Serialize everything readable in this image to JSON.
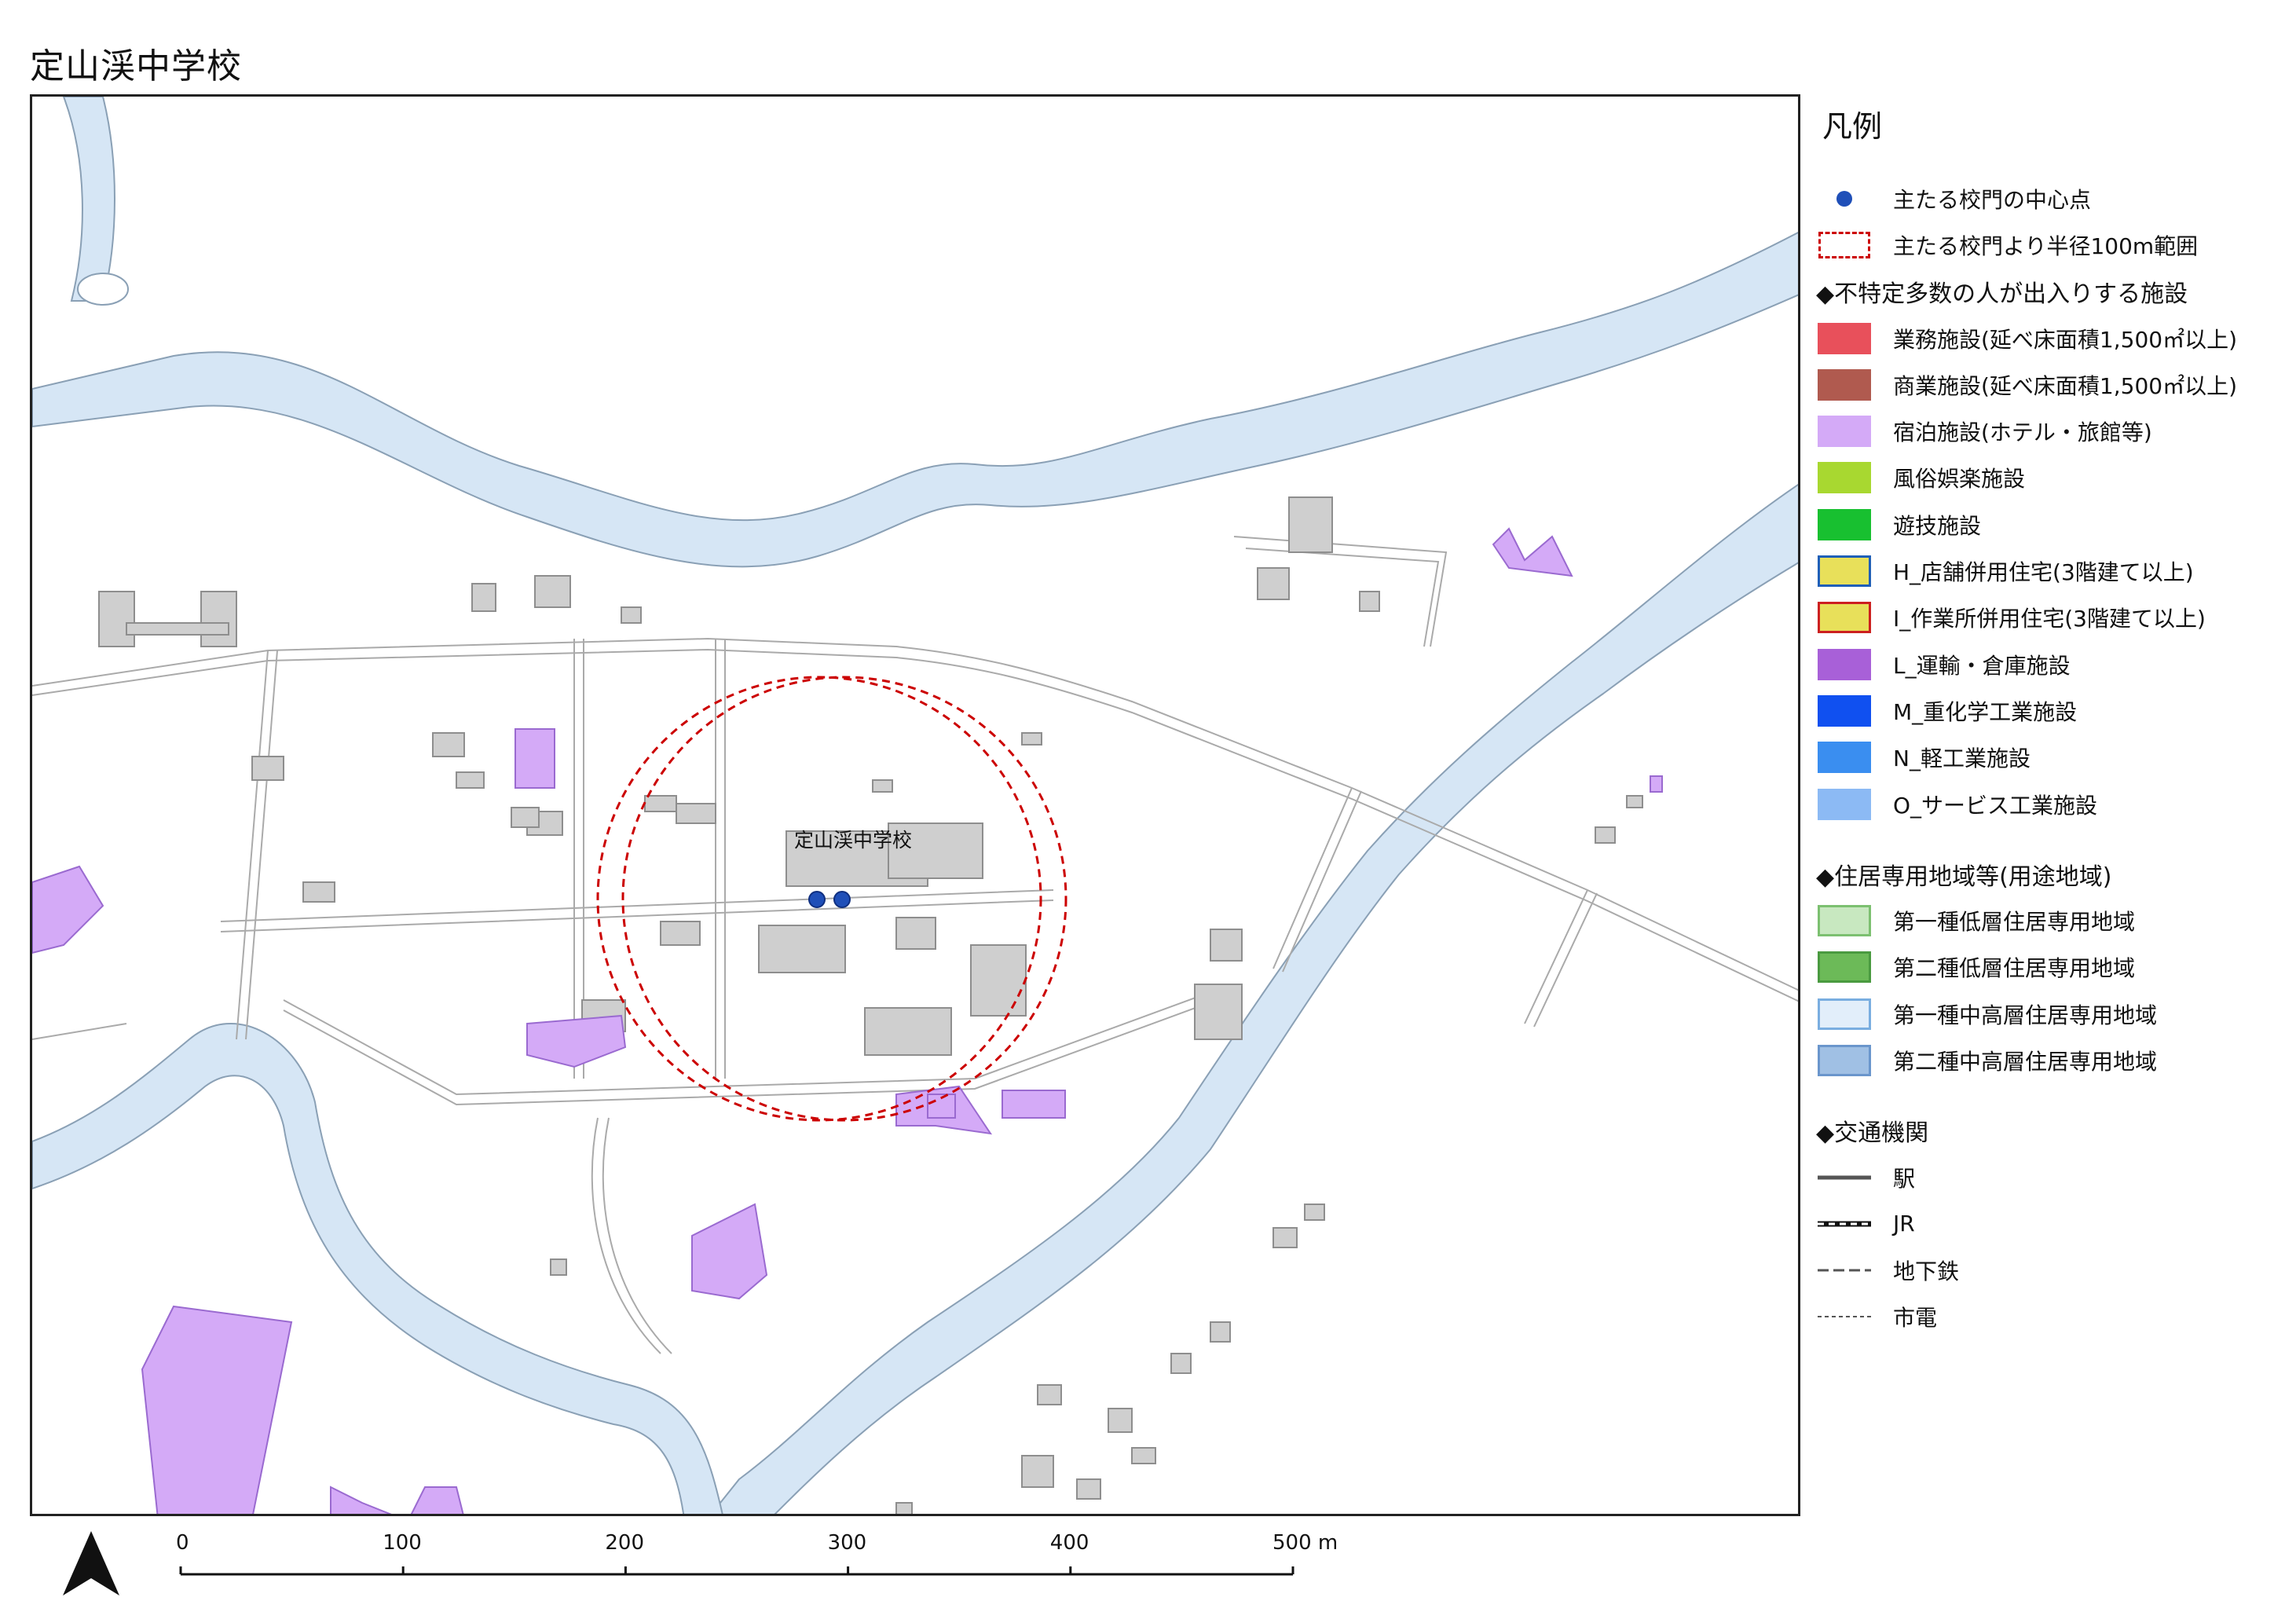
{
  "title": "定山渓中学校",
  "map": {
    "school_label": "定山渓中学校",
    "colors": {
      "water": "#d6e6f5",
      "water_edge": "#8aa0b5",
      "road_edge": "#aaaaaa",
      "building": "#cfcfcf",
      "building_edge": "#8e8e8e",
      "lodging": "#d4aaf7",
      "lodging_edge": "#9a6ad0",
      "buffer": "#cc0000",
      "gate": "#1f4fb8"
    }
  },
  "legend": {
    "title": "凡例",
    "items_top": [
      {
        "label": "主たる校門の中心点",
        "symbol": "dot",
        "color": "#1f4fb8"
      },
      {
        "label": "主たる校門より半径100m範囲",
        "symbol": "dashed-rect",
        "color": "#cc0000"
      }
    ],
    "facilities_heading": "◆不特定多数の人が出入りする施設",
    "facilities": [
      {
        "label": "業務施設(延べ床面積1,500㎡以上)",
        "fill": "#e8505b",
        "edge": "#e8505b"
      },
      {
        "label": "商業施設(延べ床面積1,500㎡以上)",
        "fill": "#b05a4f",
        "edge": "#b05a4f"
      },
      {
        "label": "宿泊施設(ホテル・旅館等)",
        "fill": "#d4aaf7",
        "edge": "#d4aaf7"
      },
      {
        "label": "風俗娯楽施設",
        "fill": "#a8d830",
        "edge": "#a8d830"
      },
      {
        "label": "遊技施設",
        "fill": "#18c030",
        "edge": "#18c030"
      },
      {
        "label": "H_店舗併用住宅(3階建て以上)",
        "fill": "#e8e05a",
        "edge": "#1f5fb8"
      },
      {
        "label": "I_作業所併用住宅(3階建て以上)",
        "fill": "#e8e05a",
        "edge": "#cc2020"
      },
      {
        "label": "L_運輸・倉庫施設",
        "fill": "#a860d8",
        "edge": "#a860d8"
      },
      {
        "label": "M_重化学工業施設",
        "fill": "#1050f0",
        "edge": "#1050f0"
      },
      {
        "label": "N_軽工業施設",
        "fill": "#3a8ef0",
        "edge": "#3a8ef0"
      },
      {
        "label": "O_サービス工業施設",
        "fill": "#8cbaf4",
        "edge": "#8cbaf4"
      }
    ],
    "zones_heading": "◆住居専用地域等(用途地域)",
    "zones": [
      {
        "label": "第一種低層住居専用地域",
        "fill": "#c8e8c0",
        "edge": "#7cc070"
      },
      {
        "label": "第二種低層住居専用地域",
        "fill": "#6cba58",
        "edge": "#4a9a40"
      },
      {
        "label": "第一種中高層住居専用地域",
        "fill": "#e2eefa",
        "edge": "#7aaee0"
      },
      {
        "label": "第二種中高層住居専用地域",
        "fill": "#a0c0e4",
        "edge": "#6a96cc"
      }
    ],
    "transport_heading": "◆交通機関",
    "transport": [
      {
        "label": "駅",
        "symbol": "solid"
      },
      {
        "label": "JR",
        "symbol": "rail"
      },
      {
        "label": "地下鉄",
        "symbol": "dashed"
      },
      {
        "label": "市電",
        "symbol": "dotted"
      }
    ]
  },
  "scale": {
    "ticks": [
      "0",
      "100",
      "200",
      "300",
      "400",
      "500 m"
    ]
  }
}
